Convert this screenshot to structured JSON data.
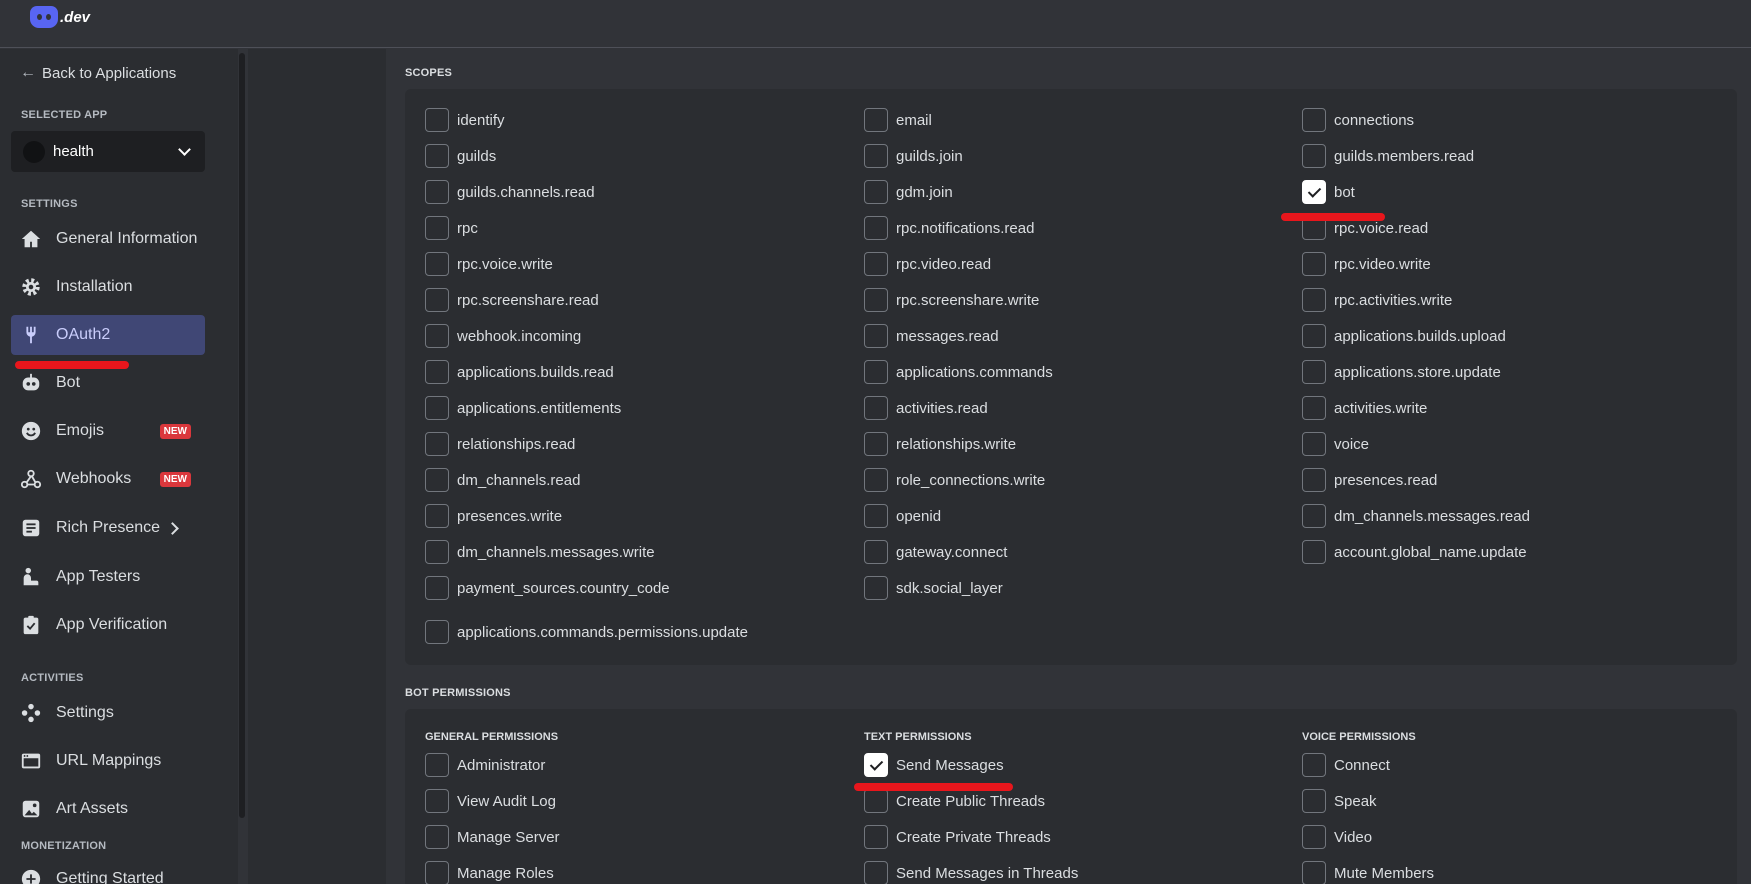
{
  "brand": {
    "logo_text": ".dev"
  },
  "sidebar": {
    "back_label": "Back to Applications",
    "selected_app_heading": "SELECTED APP",
    "selected_app_name": "health",
    "settings_heading": "SETTINGS",
    "activities_heading": "ACTIVITIES",
    "monetization_heading": "MONETIZATION",
    "new_badge": "NEW",
    "items": {
      "general": "General Information",
      "installation": "Installation",
      "oauth2": "OAuth2",
      "bot": "Bot",
      "emojis": "Emojis",
      "webhooks": "Webhooks",
      "rich_presence": "Rich Presence",
      "app_testers": "App Testers",
      "app_verification": "App Verification",
      "activities_settings": "Settings",
      "url_mappings": "URL Mappings",
      "art_assets": "Art Assets",
      "getting_started": "Getting Started"
    }
  },
  "scopes": {
    "title": "SCOPES",
    "col1": [
      {
        "label": "identify",
        "checked": false
      },
      {
        "label": "guilds",
        "checked": false
      },
      {
        "label": "guilds.channels.read",
        "checked": false
      },
      {
        "label": "rpc",
        "checked": false
      },
      {
        "label": "rpc.voice.write",
        "checked": false
      },
      {
        "label": "rpc.screenshare.read",
        "checked": false
      },
      {
        "label": "webhook.incoming",
        "checked": false
      },
      {
        "label": "applications.builds.read",
        "checked": false
      },
      {
        "label": "applications.entitlements",
        "checked": false
      },
      {
        "label": "relationships.read",
        "checked": false
      },
      {
        "label": "dm_channels.read",
        "checked": false
      },
      {
        "label": "presences.write",
        "checked": false
      },
      {
        "label": "dm_channels.messages.write",
        "checked": false
      },
      {
        "label": "payment_sources.country_code",
        "checked": false
      }
    ],
    "col2": [
      {
        "label": "email",
        "checked": false
      },
      {
        "label": "guilds.join",
        "checked": false
      },
      {
        "label": "gdm.join",
        "checked": false
      },
      {
        "label": "rpc.notifications.read",
        "checked": false
      },
      {
        "label": "rpc.video.read",
        "checked": false
      },
      {
        "label": "rpc.screenshare.write",
        "checked": false
      },
      {
        "label": "messages.read",
        "checked": false
      },
      {
        "label": "applications.commands",
        "checked": false
      },
      {
        "label": "activities.read",
        "checked": false
      },
      {
        "label": "relationships.write",
        "checked": false
      },
      {
        "label": "role_connections.write",
        "checked": false
      },
      {
        "label": "openid",
        "checked": false
      },
      {
        "label": "gateway.connect",
        "checked": false
      },
      {
        "label": "sdk.social_layer",
        "checked": false
      }
    ],
    "col3": [
      {
        "label": "connections",
        "checked": false
      },
      {
        "label": "guilds.members.read",
        "checked": false
      },
      {
        "label": "bot",
        "checked": true
      },
      {
        "label": "rpc.voice.read",
        "checked": false
      },
      {
        "label": "rpc.video.write",
        "checked": false
      },
      {
        "label": "rpc.activities.write",
        "checked": false
      },
      {
        "label": "applications.builds.upload",
        "checked": false
      },
      {
        "label": "applications.store.update",
        "checked": false
      },
      {
        "label": "activities.write",
        "checked": false
      },
      {
        "label": "voice",
        "checked": false
      },
      {
        "label": "presences.read",
        "checked": false
      },
      {
        "label": "dm_channels.messages.read",
        "checked": false
      },
      {
        "label": "account.global_name.update",
        "checked": false
      }
    ],
    "last": {
      "label": "applications.commands.permissions.update",
      "checked": false
    }
  },
  "bot_permissions": {
    "title": "BOT PERMISSIONS",
    "general_heading": "GENERAL PERMISSIONS",
    "text_heading": "TEXT PERMISSIONS",
    "voice_heading": "VOICE PERMISSIONS",
    "general": [
      {
        "label": "Administrator",
        "checked": false
      },
      {
        "label": "View Audit Log",
        "checked": false
      },
      {
        "label": "Manage Server",
        "checked": false
      },
      {
        "label": "Manage Roles",
        "checked": false
      }
    ],
    "text": [
      {
        "label": "Send Messages",
        "checked": true
      },
      {
        "label": "Create Public Threads",
        "checked": false
      },
      {
        "label": "Create Private Threads",
        "checked": false
      },
      {
        "label": "Send Messages in Threads",
        "checked": false
      }
    ],
    "voice": [
      {
        "label": "Connect",
        "checked": false
      },
      {
        "label": "Speak",
        "checked": false
      },
      {
        "label": "Video",
        "checked": false
      },
      {
        "label": "Mute Members",
        "checked": false
      }
    ]
  },
  "colors": {
    "accent": "#5865f2",
    "annotation_red": "#e8161c",
    "badge_red": "#da373c"
  }
}
